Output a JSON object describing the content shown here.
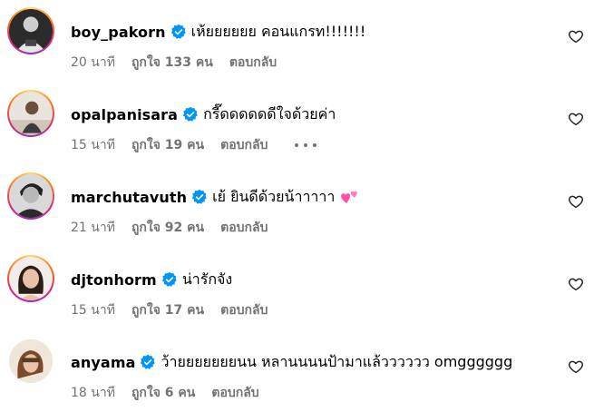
{
  "comments": [
    {
      "username": "boy_pakorn",
      "text": "เห้ยยยยยย คอนแกรท!!!!!!!",
      "time": "20 นาที",
      "likes": "ถูกใจ 133 คน",
      "reply": "ตอบกลับ",
      "verified": true,
      "story_ring": true
    },
    {
      "username": "opalpanisara",
      "text": "กรี๊ดดดดดดีใจด้วยค่า",
      "time": "15 นาที",
      "likes": "ถูกใจ 19 คน",
      "reply": "ตอบกลับ",
      "verified": true,
      "story_ring": true,
      "more_options": true
    },
    {
      "username": "marchutavuth",
      "text": "เย้ ยินดีด้วยน้าาาาา",
      "emoji": "two-hearts",
      "time": "21 นาที",
      "likes": "ถูกใจ 92 คน",
      "reply": "ตอบกลับ",
      "verified": true,
      "story_ring": true
    },
    {
      "username": "djtonhorm",
      "text": "น่ารักจัง",
      "time": "15 นาที",
      "likes": "ถูกใจ 17 คน",
      "reply": "ตอบกลับ",
      "verified": true,
      "story_ring": true
    },
    {
      "username": "anyama",
      "text": "ว้ายยยยยยยนน หลานนนนป้ามาแล้วววววว omgggggg",
      "time": "18 นาที",
      "likes": "ถูกใจ 6 คน",
      "reply": "ตอบกลับ",
      "verified": true,
      "story_ring": false
    }
  ],
  "icons": {
    "verified": "verified-badge-icon",
    "like": "heart-outline-icon",
    "more": "more-options-icon"
  },
  "colors": {
    "verified_blue": "#0095f6",
    "meta_gray": "#737373",
    "emoji_pink": "#ff4fa3"
  }
}
